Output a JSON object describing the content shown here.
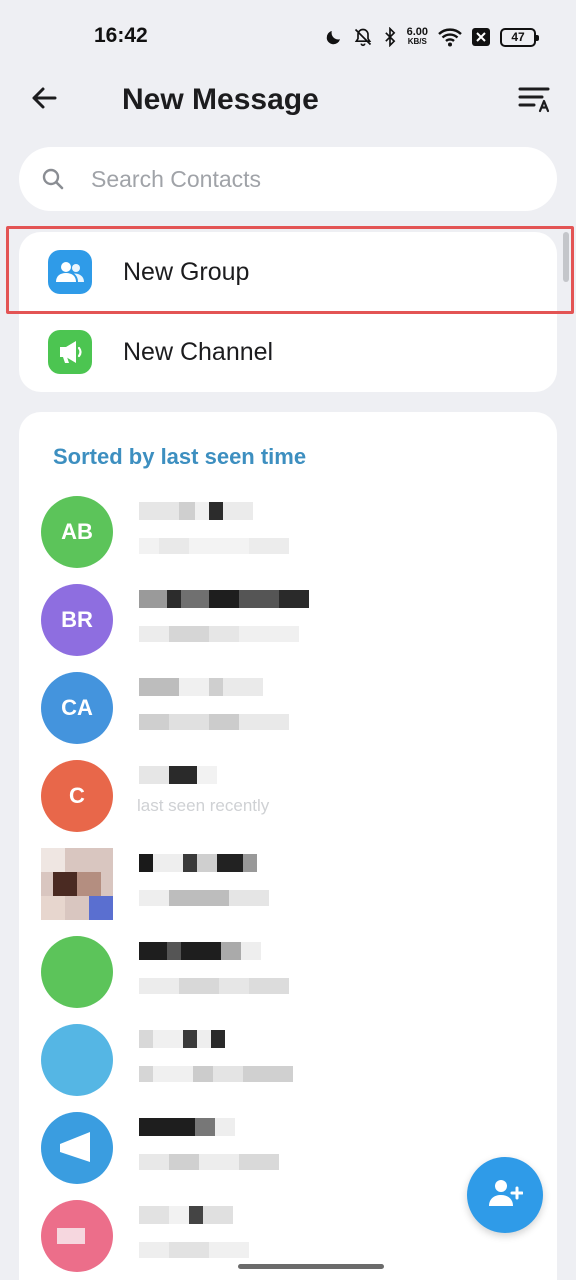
{
  "status_bar": {
    "time": "16:42",
    "net_speed_value": "6.00",
    "net_speed_unit": "KB/S",
    "battery": "47",
    "icons": [
      "moon-icon",
      "mute-bell-icon",
      "bluetooth-icon",
      "wifi-icon",
      "close-box-icon"
    ]
  },
  "header": {
    "title": "New Message",
    "back_icon": "arrow-left-icon",
    "sort_icon": "sort-az-icon"
  },
  "search": {
    "placeholder": "Search Contacts",
    "value": ""
  },
  "actions": [
    {
      "label": "New Group",
      "icon": "group-icon",
      "color": "#2f9be8"
    },
    {
      "label": "New Channel",
      "icon": "megaphone-icon",
      "color": "#4cc551"
    }
  ],
  "contacts": {
    "section_title": "Sorted by last seen time",
    "items": [
      {
        "initials": "AB",
        "color": "#5cc45a"
      },
      {
        "initials": "BR",
        "color": "#8e6ee0"
      },
      {
        "initials": "CA",
        "color": "#4494dd"
      },
      {
        "initials": "C",
        "color": "#e8674a",
        "status": "last seen recently"
      },
      {
        "initials": "",
        "color": "#d9c6c0"
      },
      {
        "initials": "",
        "color": "#5cc45a"
      },
      {
        "initials": "",
        "color": "#55b6e4"
      },
      {
        "initials": "",
        "color": "#3a9de0"
      },
      {
        "initials": "",
        "color": "#ec6e8a"
      }
    ]
  },
  "fab": {
    "icon": "add-contact-icon",
    "color": "#2f9be8"
  }
}
